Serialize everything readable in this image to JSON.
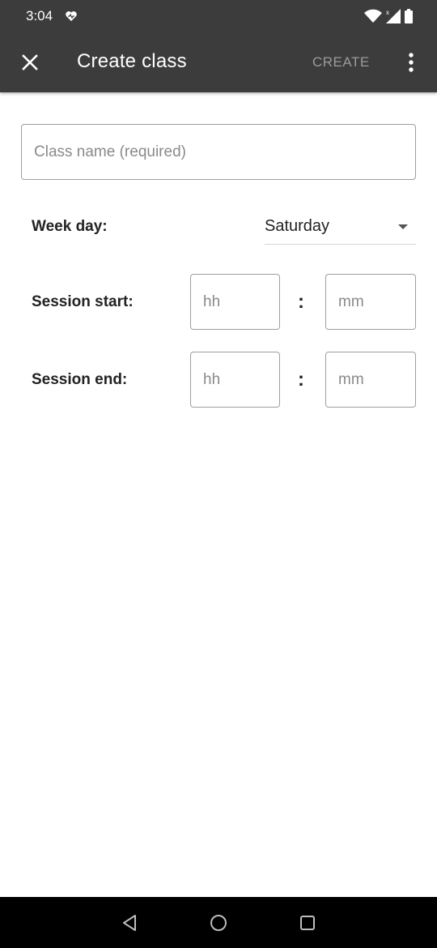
{
  "status": {
    "time": "3:04"
  },
  "appbar": {
    "title": "Create class",
    "create_label": "CREATE"
  },
  "form": {
    "class_name_placeholder": "Class name (required)",
    "week_day_label": "Week day:",
    "week_day_value": "Saturday",
    "session_start_label": "Session start:",
    "session_end_label": "Session end:",
    "hour_placeholder": "hh",
    "minute_placeholder": "mm",
    "colon": ":"
  },
  "icons": {
    "close": "close-icon",
    "more": "more-vert-icon",
    "back": "nav-back-icon",
    "home": "nav-home-icon",
    "recents": "nav-recents-icon"
  }
}
